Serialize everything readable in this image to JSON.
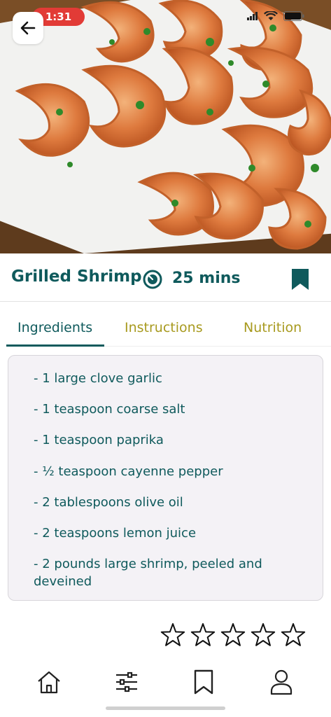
{
  "status_bar": {
    "time": "1:31"
  },
  "recipe": {
    "title": "Grilled Shrimp",
    "time": "25 mins"
  },
  "tabs": [
    {
      "label": "Ingredients",
      "active": true
    },
    {
      "label": "Instructions",
      "active": false
    },
    {
      "label": "Nutrition",
      "active": false
    }
  ],
  "ingredients": [
    "- 1 large clove garlic",
    "- 1 teaspoon coarse salt",
    "- 1 teaspoon paprika",
    "- ½ teaspoon cayenne pepper",
    "- 2 tablespoons olive oil",
    "- 2 teaspoons lemon juice",
    "- 2 pounds large shrimp, peeled and deveined"
  ],
  "rating": {
    "value": 0,
    "max": 5
  },
  "nav": [
    {
      "icon": "home-icon"
    },
    {
      "icon": "filter-sliders-icon"
    },
    {
      "icon": "bookmark-icon"
    },
    {
      "icon": "profile-icon"
    }
  ],
  "colors": {
    "accent": "#0f5a5c",
    "inactive_tab": "#a89a1f",
    "status_pill": "#e23b36",
    "card_bg": "#f4f2f6"
  }
}
